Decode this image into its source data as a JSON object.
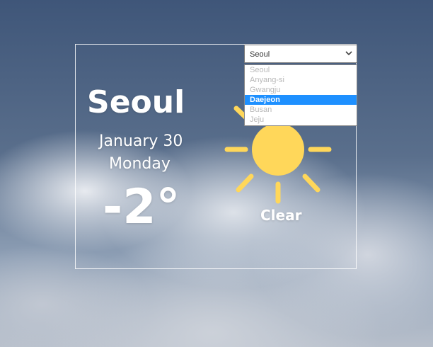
{
  "weather": {
    "city": "Seoul",
    "date": "January 30",
    "day": "Monday",
    "temperature": "-2°",
    "condition": "Clear",
    "icon": "sun-icon"
  },
  "city_select": {
    "selected_value": "Seoul",
    "options": [
      "Seoul",
      "Anyang-si",
      "Gwangju",
      "Daejeon",
      "Busan",
      "Jeju"
    ],
    "highlighted_option": "Daejeon"
  },
  "colors": {
    "sun": "#ffd75a",
    "highlight": "#1e90ff",
    "text": "#ffffff"
  }
}
